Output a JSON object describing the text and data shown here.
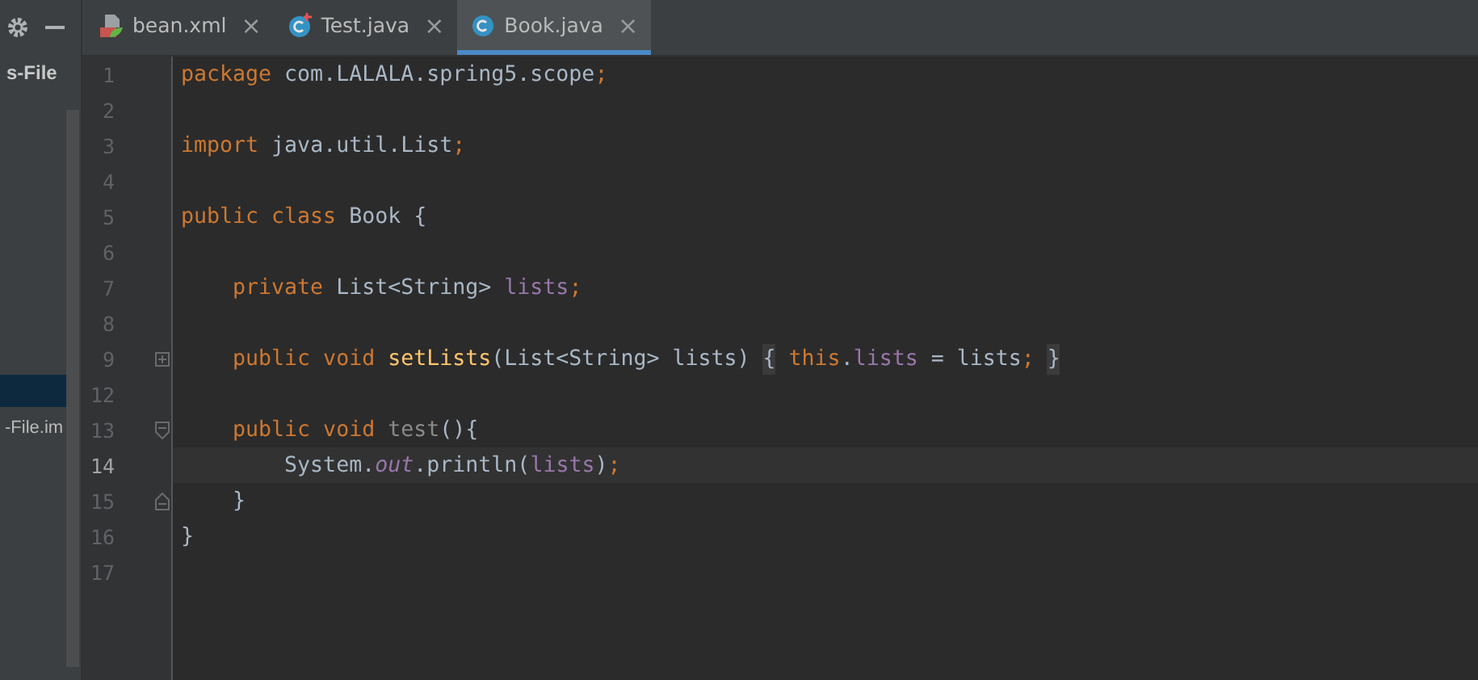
{
  "project_panel": {
    "header": "s-File",
    "items": [
      {
        "kind": "blank",
        "selected": true
      },
      {
        "kind": "file",
        "label": "-File.im",
        "selected": false
      }
    ]
  },
  "tabs": [
    {
      "label": "bean.xml",
      "kind": "xml",
      "selected": false,
      "close": "×"
    },
    {
      "label": "Test.java",
      "kind": "runnable-class",
      "selected": false,
      "close": "×"
    },
    {
      "label": "Book.java",
      "kind": "class",
      "selected": true,
      "close": "×"
    }
  ],
  "editor": {
    "lines": [
      {
        "number": "1",
        "kind": "code",
        "tokens": [
          {
            "kind": "keyword",
            "text": "package "
          },
          {
            "kind": "plain",
            "text": "com.LALALA.spring5.scope"
          },
          {
            "kind": "punct",
            "text": ";"
          }
        ]
      },
      {
        "number": "2",
        "kind": "code"
      },
      {
        "number": "3",
        "kind": "code",
        "tokens": [
          {
            "kind": "keyword",
            "text": "import "
          },
          {
            "kind": "plain",
            "text": "java.util.List"
          },
          {
            "kind": "punct",
            "text": ";"
          }
        ]
      },
      {
        "number": "4",
        "kind": "code"
      },
      {
        "number": "5",
        "kind": "code",
        "tokens": [
          {
            "kind": "keyword",
            "text": "public class "
          },
          {
            "kind": "plain",
            "text": "Book {"
          }
        ]
      },
      {
        "number": "6",
        "kind": "code"
      },
      {
        "number": "7",
        "kind": "code",
        "tokens": [
          {
            "kind": "keyword",
            "text": "    private "
          },
          {
            "kind": "plain",
            "text": "List<String> "
          },
          {
            "kind": "field",
            "text": "lists"
          },
          {
            "kind": "punct",
            "text": ";"
          }
        ]
      },
      {
        "number": "8",
        "kind": "code"
      },
      {
        "number": "9",
        "kind": "fold-collapsed",
        "tokens": [
          {
            "kind": "keyword",
            "text": "    public void "
          },
          {
            "kind": "method",
            "text": "setLists"
          },
          {
            "kind": "plain",
            "text": "(List<String> lists) "
          },
          {
            "kind": "fold-brace",
            "text": "{"
          },
          {
            "kind": "keyword",
            "text": " this"
          },
          {
            "kind": "plain",
            "text": "."
          },
          {
            "kind": "field",
            "text": "lists"
          },
          {
            "kind": "plain",
            "text": " = lists"
          },
          {
            "kind": "punct",
            "text": "; "
          },
          {
            "kind": "fold-brace",
            "text": "}"
          }
        ]
      },
      {
        "number": "12",
        "kind": "code"
      },
      {
        "number": "13",
        "kind": "fold-start",
        "tokens": [
          {
            "kind": "keyword",
            "text": "    public void "
          },
          {
            "kind": "unused",
            "text": "test"
          },
          {
            "kind": "plain",
            "text": "(){"
          }
        ]
      },
      {
        "number": "14",
        "kind": "code",
        "current": true,
        "tokens": [
          {
            "kind": "plain",
            "text": "        System."
          },
          {
            "kind": "static",
            "text": "out"
          },
          {
            "kind": "plain",
            "text": ".println("
          },
          {
            "kind": "field",
            "text": "lists"
          },
          {
            "kind": "plain",
            "text": ")"
          },
          {
            "kind": "punct",
            "text": ";"
          }
        ]
      },
      {
        "number": "15",
        "kind": "fold-end",
        "tokens": [
          {
            "kind": "plain",
            "text": "    }"
          }
        ]
      },
      {
        "number": "16",
        "kind": "code",
        "tokens": [
          {
            "kind": "plain",
            "text": "}"
          }
        ]
      },
      {
        "number": "17",
        "kind": "code"
      }
    ]
  }
}
